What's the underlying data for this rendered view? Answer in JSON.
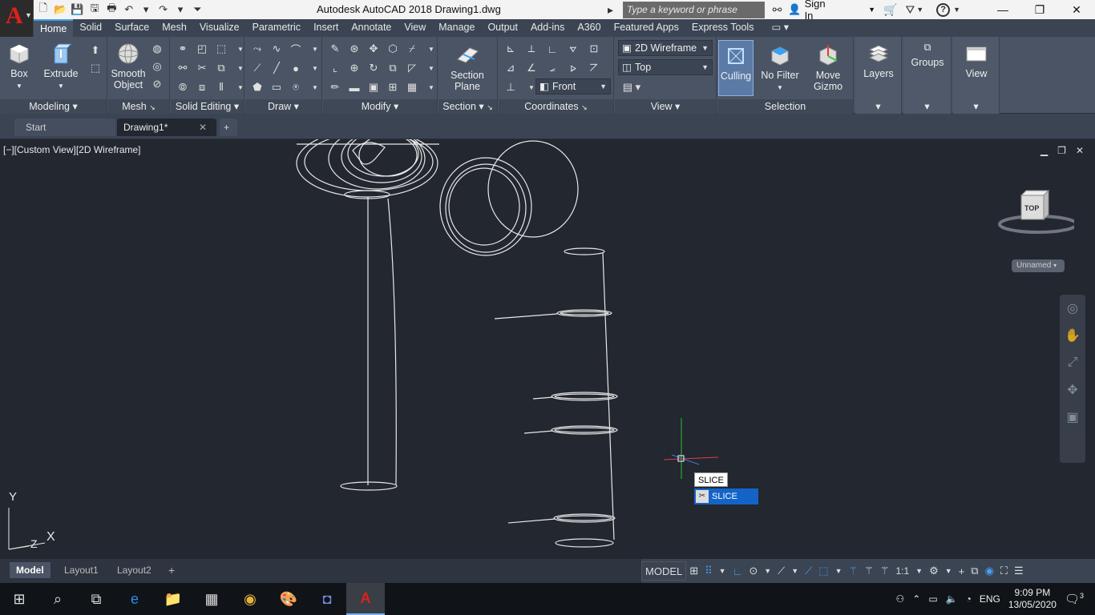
{
  "window": {
    "title": "Autodesk AutoCAD 2018    Drawing1.dwg",
    "app_letter": "A",
    "search_placeholder": "Type a keyword or phrase",
    "sign_in": "Sign In",
    "help": "?"
  },
  "ribbon_tabs": [
    "Home",
    "Solid",
    "Surface",
    "Mesh",
    "Visualize",
    "Parametric",
    "Insert",
    "Annotate",
    "View",
    "Manage",
    "Output",
    "Add-ins",
    "A360",
    "Featured Apps",
    "Express Tools"
  ],
  "active_tab": "Home",
  "panels": {
    "modeling": {
      "title": "Modeling",
      "box": "Box",
      "extrude": "Extrude"
    },
    "mesh": {
      "title": "Mesh",
      "smooth1": "Smooth",
      "smooth2": "Object"
    },
    "solid_editing": {
      "title": "Solid Editing"
    },
    "draw": {
      "title": "Draw"
    },
    "modify": {
      "title": "Modify"
    },
    "section": {
      "title": "Section",
      "sp1": "Section",
      "sp2": "Plane"
    },
    "coordinates": {
      "title": "Coordinates"
    },
    "view": {
      "title": "View",
      "visual_style": "2D Wireframe",
      "view_top": "Top",
      "view_front": "Front"
    },
    "selection": {
      "title": "Selection",
      "culling": "Culling",
      "no_filter": "No Filter",
      "move1": "Move",
      "move2": "Gizmo"
    },
    "layers": {
      "label": "Layers"
    },
    "groups": {
      "label": "Groups"
    },
    "viewpanel": {
      "label": "View"
    }
  },
  "doc_tabs": [
    "Start",
    "Drawing1*"
  ],
  "viewport": {
    "label": "[−][Custom View][2D Wireframe]",
    "viewcube_face": "TOP",
    "ucs_name": "Unnamed",
    "ucs_y": "Y",
    "ucs_x": "X",
    "ucs_z": "Z"
  },
  "command": {
    "input": "SLICE",
    "suggestion": "SLICE"
  },
  "layout_tabs": [
    "Model",
    "Layout1",
    "Layout2"
  ],
  "status": {
    "model": "MODEL",
    "scale": "1:1"
  },
  "taskbar": {
    "lang": "ENG",
    "time": "9:09 PM",
    "date": "13/05/2020",
    "notif": "3"
  },
  "colors": {
    "accent": "#3aa0f0",
    "viewport_bg": "#222730",
    "ribbon_bg": "#4a5464",
    "highlight": "#1464c8"
  }
}
